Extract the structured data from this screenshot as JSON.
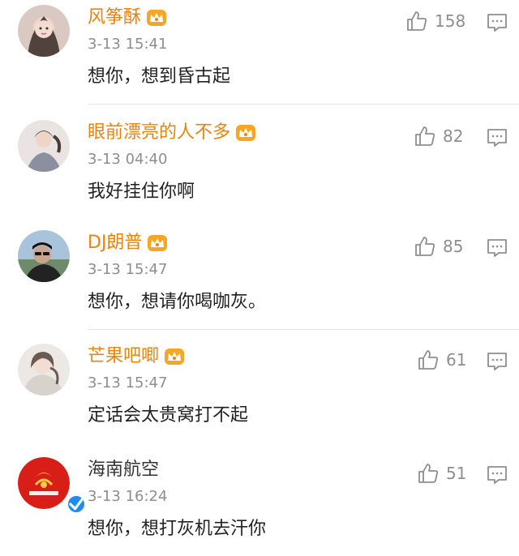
{
  "comments": [
    {
      "username": "风筝酥",
      "timestamp": "3-13 15:41",
      "text": "想你，想到昏古起",
      "likes": "158",
      "vip_icon": "crown-icon"
    },
    {
      "username": "眼前漂亮的人不多",
      "timestamp": "3-13 04:40",
      "text": "我好挂住你啊",
      "likes": "82",
      "vip_icon": "crown-icon"
    },
    {
      "username": "DJ朗普",
      "timestamp": "3-13 15:47",
      "text": "想你，想请你喝咖灰。",
      "likes": "85",
      "vip_icon": "crown-icon"
    },
    {
      "username": "芒果吧唧",
      "timestamp": "3-13 15:47",
      "text": "定话会太贵窝打不起",
      "likes": "61",
      "vip_icon": "crown-icon"
    },
    {
      "username": "海南航空",
      "timestamp": "3-13 16:24",
      "text": "想你，想打灰机去汗你",
      "likes": "51",
      "verified_icon": "verified-badge-icon"
    }
  ],
  "colors": {
    "vip_name": "#e8840c",
    "normal_name": "#333333",
    "meta": "#8e8e8e",
    "verified": "#1d8cf0"
  },
  "icons": {
    "like": "thumbs-up-icon",
    "reply": "comment-icon"
  }
}
